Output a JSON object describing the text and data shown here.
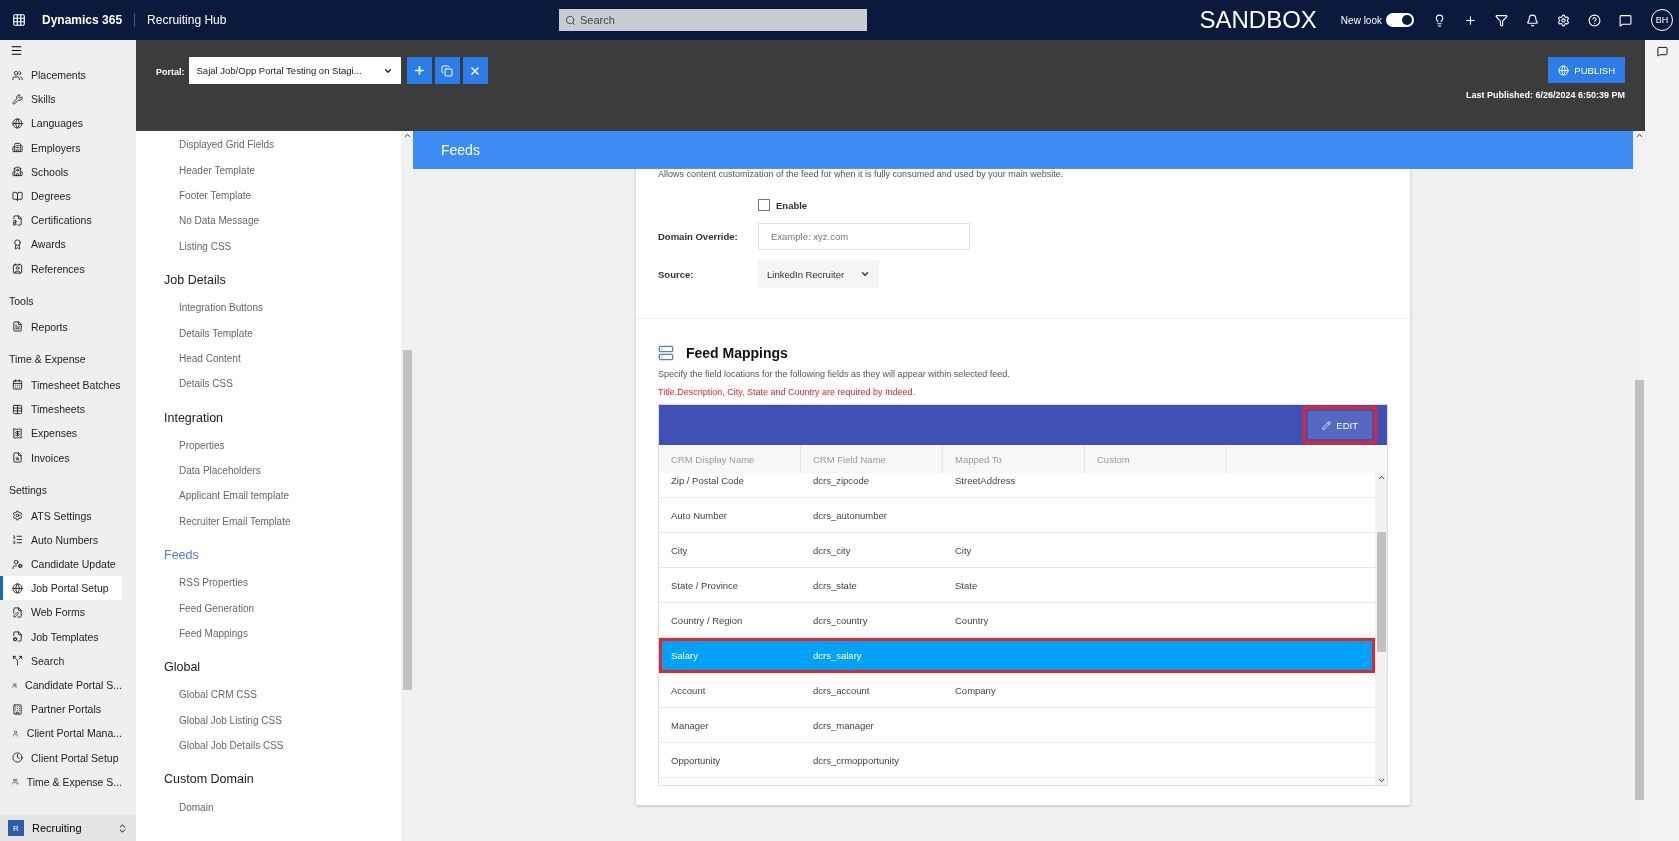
{
  "topbar": {
    "app": "Dynamics 365",
    "area": "Recruiting Hub",
    "search": {
      "placeholder": "Search"
    },
    "environment": "SANDBOX",
    "new_look": {
      "label": "New look",
      "on": true
    },
    "avatar": "BH"
  },
  "left_nav": {
    "groups": [
      {
        "items": [
          {
            "label": "Placements",
            "selected": false
          },
          {
            "label": "Skills",
            "selected": false
          },
          {
            "label": "Languages",
            "selected": false
          },
          {
            "label": "Employers",
            "selected": false
          },
          {
            "label": "Schools",
            "selected": false
          },
          {
            "label": "Degrees",
            "selected": false
          },
          {
            "label": "Certifications",
            "selected": false
          },
          {
            "label": "Awards",
            "selected": false
          },
          {
            "label": "References",
            "selected": false
          }
        ]
      },
      {
        "title": "Tools",
        "items": [
          {
            "label": "Reports",
            "selected": false
          }
        ]
      },
      {
        "title": "Time & Expense",
        "items": [
          {
            "label": "Timesheet Batches",
            "selected": false
          },
          {
            "label": "Timesheets",
            "selected": false
          },
          {
            "label": "Expenses",
            "selected": false
          },
          {
            "label": "Invoices",
            "selected": false
          }
        ]
      },
      {
        "title": "Settings",
        "items": [
          {
            "label": "ATS Settings",
            "selected": false
          },
          {
            "label": "Auto Numbers",
            "selected": false
          },
          {
            "label": "Candidate Update",
            "selected": false
          },
          {
            "label": "Job Portal Setup",
            "selected": true
          },
          {
            "label": "Web Forms",
            "selected": false
          },
          {
            "label": "Job Templates",
            "selected": false
          },
          {
            "label": "Search",
            "selected": false
          },
          {
            "label": "Candidate Portal S...",
            "selected": false
          },
          {
            "label": "Partner Portals",
            "selected": false
          },
          {
            "label": "Client Portal Mana...",
            "selected": false
          },
          {
            "label": "Client Portal Setup",
            "selected": false
          },
          {
            "label": "Time & Expense S...",
            "selected": false
          }
        ]
      }
    ],
    "area_switcher": {
      "badge": "R",
      "label": "Recruiting"
    }
  },
  "portal_bar": {
    "label": "Portal:",
    "portal": "Sajal Job/Opp Portal Testing on Stagi...",
    "publish": "PUBLISH",
    "last_published": "Last Published: 6/26/2024 6:50:39 PM"
  },
  "settings_nav": [
    {
      "items": [
        "Displayed Grid Fields",
        "Header Template",
        "Footer Template",
        "No Data Message",
        "Listing CSS"
      ]
    },
    {
      "title": "Job Details",
      "selected": false,
      "items": [
        "Integration Buttons",
        "Details Template",
        "Head Content",
        "Details CSS"
      ]
    },
    {
      "title": "Integration",
      "selected": false,
      "items": [
        "Properties",
        "Data Placeholders",
        "Applicant Email template",
        "Recruiter Email Template"
      ]
    },
    {
      "title": "Feeds",
      "selected": true,
      "items": [
        "RSS Properties",
        "Feed Generation",
        "Feed Mappings"
      ]
    },
    {
      "title": "Global",
      "selected": false,
      "items": [
        "Global CRM CSS",
        "Global Job Listing CSS",
        "Global Job Details CSS"
      ]
    },
    {
      "title": "Custom Domain",
      "selected": false,
      "items": [
        "Domain"
      ]
    }
  ],
  "section_title": "Feeds",
  "feed_generation": {
    "description": "Allows content customization of the feed for when it is fully consumed and used by your main website.",
    "enable": {
      "label": "Enable",
      "checked": false
    },
    "domain_override": {
      "label": "Domain Override:",
      "placeholder": "Example: xyz.com"
    },
    "source": {
      "label": "Source:",
      "value": "LinkedIn Recruiter"
    }
  },
  "feed_mappings": {
    "title": "Feed Mappings",
    "subtitle": "Specify the field locations for the following fields as they will appear within selected feed.",
    "warning": "Title,Description, City, State and Country are required by Indeed.",
    "edit": {
      "label": "EDIT",
      "highlighted": true
    },
    "columns": [
      "CRM Display Name",
      "CRM Field Name",
      "Mapped To",
      "Custom"
    ],
    "rows": [
      {
        "display": "Zip / Postal Code",
        "field": "dcrs_zipcode",
        "mapped": "StreetAddress",
        "selected": false
      },
      {
        "display": "Auto Number",
        "field": "dcrs_autonumber",
        "selected": false
      },
      {
        "display": "City",
        "field": "dcrs_city",
        "mapped": "City",
        "selected": false
      },
      {
        "display": "State / Province",
        "field": "dcrs_state",
        "mapped": "State",
        "selected": false
      },
      {
        "display": "Country / Region",
        "field": "dcrs_country",
        "mapped": "Country",
        "selected": false
      },
      {
        "display": "Salary",
        "field": "dcrs_salary",
        "selected": true
      },
      {
        "display": "Account",
        "field": "dcrs_account",
        "mapped": "Company",
        "selected": false
      },
      {
        "display": "Manager",
        "field": "dcrs_manager",
        "selected": false
      },
      {
        "display": "Opportunity",
        "field": "dcrs_crmopportunity",
        "selected": false
      }
    ]
  }
}
